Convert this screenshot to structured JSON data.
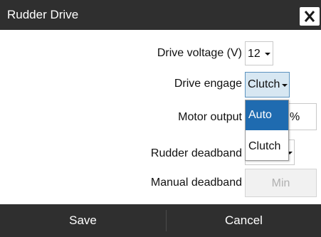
{
  "dialog": {
    "title": "Rudder Drive",
    "close_icon": "close-icon"
  },
  "fields": {
    "drive_voltage": {
      "label": "Drive voltage (V)",
      "value": "12"
    },
    "drive_engage": {
      "label": "Drive engage",
      "value": "Clutch"
    },
    "motor_output": {
      "label": "Motor output",
      "unit": "%"
    },
    "rudder_deadband": {
      "label": "Rudder deadband"
    },
    "manual_deadband": {
      "label": "Manual deadband",
      "value": "Min"
    }
  },
  "dropdown": {
    "options": [
      "Auto",
      "Clutch"
    ],
    "highlighted": "Auto"
  },
  "footer": {
    "save_label": "Save",
    "cancel_label": "Cancel"
  },
  "colors": {
    "titlebar": "#2f2f2f",
    "highlight": "#1f6bb0",
    "active_field": "#d7e7f2"
  }
}
